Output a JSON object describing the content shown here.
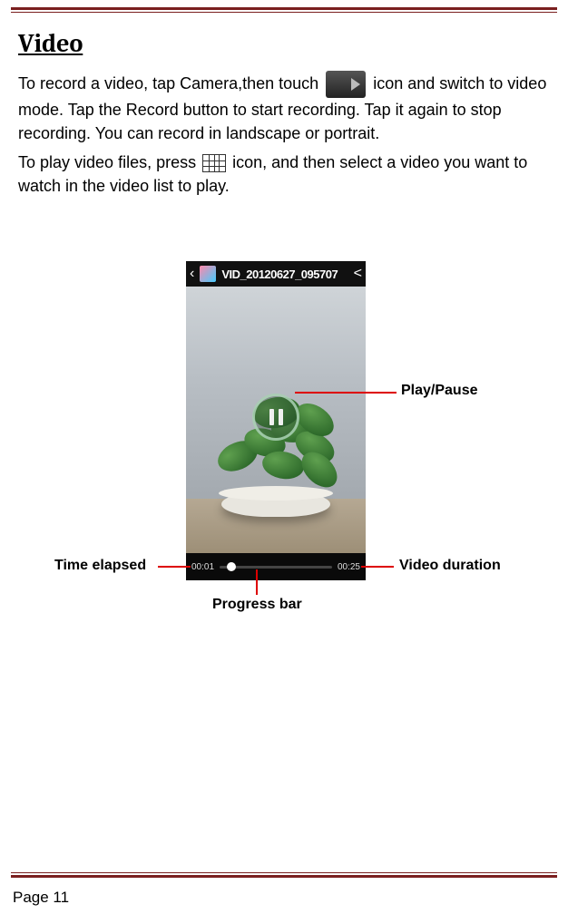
{
  "page": {
    "title": "Video",
    "para1_before_icon": "To record a video, tap Camera,then touch ",
    "para1_after_icon": " icon and switch to video mode. Tap the Record button to start recording. Tap it again to stop recording. You can record in landscape or portrait.",
    "para2_before_icon": "To play video files, press ",
    "para2_after_icon": "icon, and then select a video you want to watch in the video list to play.",
    "footer": "Page 11"
  },
  "screenshot": {
    "video_title": "VID_20120627_095707",
    "time_elapsed": "00:01",
    "video_duration": "00:25"
  },
  "callouts": {
    "play_pause": "Play/Pause",
    "time_elapsed": "Time elapsed",
    "video_duration": "Video duration",
    "progress_bar": "Progress bar"
  }
}
